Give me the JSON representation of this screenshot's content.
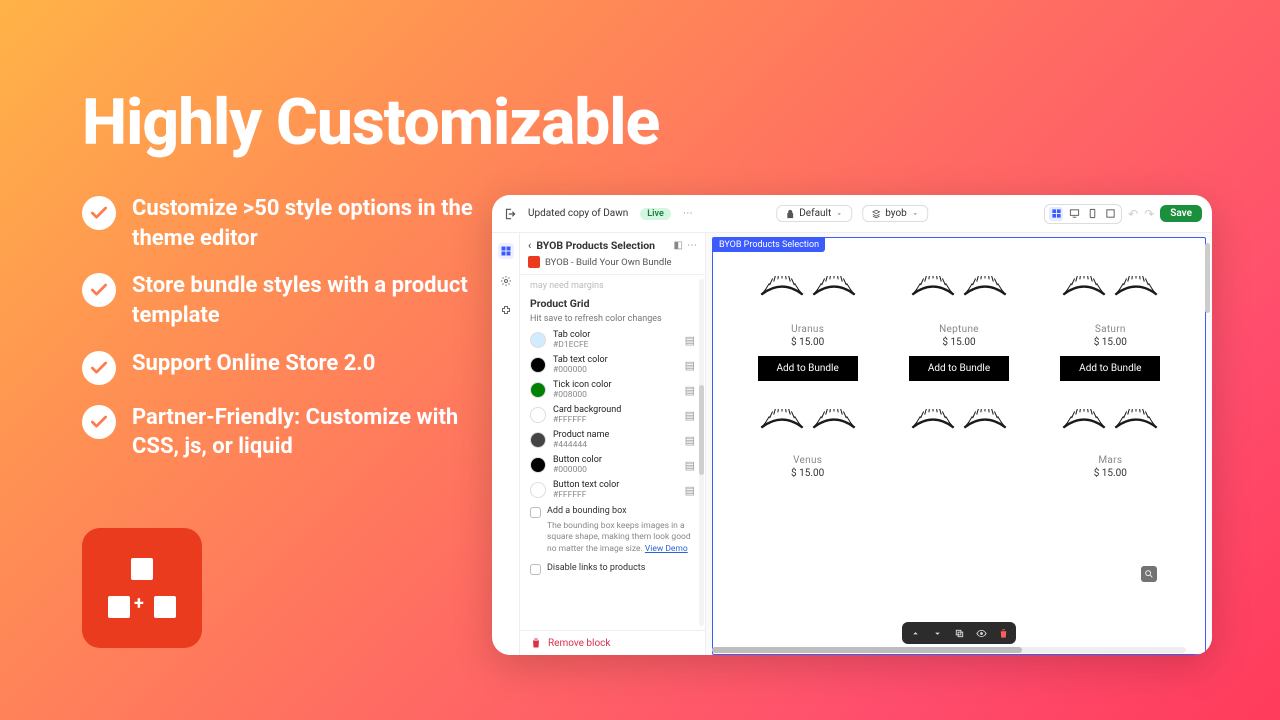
{
  "hero": {
    "title": "Highly Customizable"
  },
  "bullets": [
    "Customize >50 style options in the theme editor",
    "Store bundle styles with a product template",
    "Support Online Store 2.0",
    "Partner-Friendly: Customize with CSS, js, or liquid"
  ],
  "topbar": {
    "theme_name": "Updated copy of Dawn",
    "live_label": "Live",
    "default_label": "Default",
    "template_label": "byob",
    "save_label": "Save"
  },
  "sidepanel": {
    "title": "BYOB Products Selection",
    "app_label": "BYOB - Build Your Own Bundle",
    "faded_hint": "may need margins",
    "section_title": "Product Grid",
    "section_hint": "Hit save to refresh color changes",
    "swatches": [
      {
        "name": "Tab color",
        "hex": "#D1ECFE",
        "fill": "#d1ecfe"
      },
      {
        "name": "Tab text color",
        "hex": "#000000",
        "fill": "#000000"
      },
      {
        "name": "Tick icon color",
        "hex": "#008000",
        "fill": "#008000"
      },
      {
        "name": "Card background",
        "hex": "#FFFFFF",
        "fill": "#ffffff"
      },
      {
        "name": "Product name",
        "hex": "#444444",
        "fill": "#444444"
      },
      {
        "name": "Button color",
        "hex": "#000000",
        "fill": "#000000"
      },
      {
        "name": "Button text color",
        "hex": "#FFFFFF",
        "fill": "#ffffff"
      }
    ],
    "bounding_label": "Add a bounding box",
    "bounding_desc": "The bounding box keeps images in a square shape, making them look good no matter the image size.",
    "view_demo": "View Demo",
    "disable_links_label": "Disable links to products",
    "remove_block": "Remove block"
  },
  "canvas": {
    "sel_tag": "BYOB Products Selection",
    "add_label": "Add to Bundle",
    "products_r1": [
      {
        "name": "Uranus",
        "price": "$ 15.00"
      },
      {
        "name": "Neptune",
        "price": "$ 15.00"
      },
      {
        "name": "Saturn",
        "price": "$ 15.00"
      }
    ],
    "products_r2": [
      {
        "name": "Venus",
        "price": "$ 15.00"
      },
      {
        "name": "",
        "price": ""
      },
      {
        "name": "Mars",
        "price": "$ 15.00"
      }
    ]
  }
}
